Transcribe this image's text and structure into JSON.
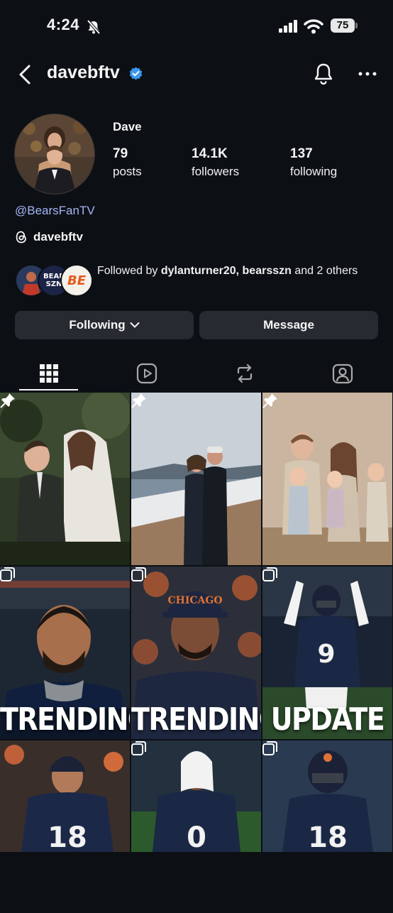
{
  "status_bar": {
    "time": "4:24",
    "battery": "75"
  },
  "header": {
    "username": "davebftv"
  },
  "profile": {
    "display_name": "Dave",
    "stats": [
      {
        "value": "79",
        "label": "posts"
      },
      {
        "value": "14.1K",
        "label": "followers"
      },
      {
        "value": "137",
        "label": "following"
      }
    ],
    "link": "@BearsFanTV",
    "threads_handle": "davebftv",
    "followed_by": {
      "prefix": "Followed by ",
      "names": "dylanturner20, bearsszn",
      "suffix": " and 2 others",
      "avatar_texts": [
        "BEARS SZN",
        "BE"
      ]
    }
  },
  "buttons": {
    "following": "Following",
    "message": "Message"
  },
  "tabs": [
    "grid",
    "reels",
    "reposts",
    "tagged"
  ],
  "grid": [
    {
      "type": "photo",
      "pinned": true,
      "word": ""
    },
    {
      "type": "photo",
      "pinned": true,
      "word": ""
    },
    {
      "type": "photo",
      "pinned": true,
      "word": ""
    },
    {
      "type": "carousel",
      "pinned": false,
      "word": "TRENDING"
    },
    {
      "type": "carousel",
      "pinned": false,
      "word": "TRENDING"
    },
    {
      "type": "carousel",
      "pinned": false,
      "word": "UPDATE"
    },
    {
      "type": "carousel",
      "pinned": false,
      "word": ""
    },
    {
      "type": "carousel",
      "pinned": false,
      "word": ""
    },
    {
      "type": "carousel",
      "pinned": false,
      "word": ""
    }
  ],
  "colors": {
    "background": "#0c1014",
    "button": "#272b31",
    "link": "#a6b4f6",
    "verified": "#3897f0"
  }
}
